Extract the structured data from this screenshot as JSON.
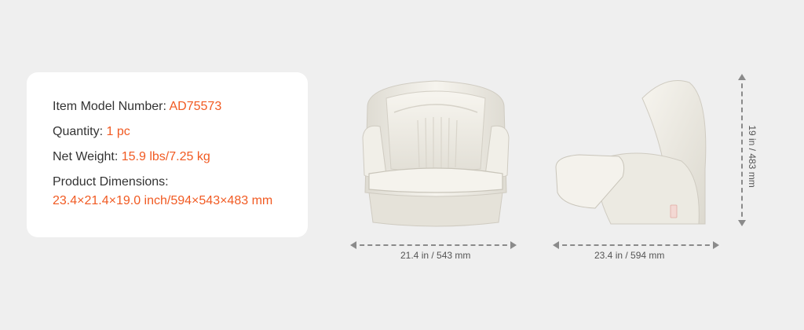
{
  "specs": {
    "model_label": "Item Model Number:",
    "model_value": "AD75573",
    "quantity_label": "Quantity:",
    "quantity_value": "1 pc",
    "weight_label": "Net Weight:",
    "weight_value": "15.9 lbs/7.25 kg",
    "dimensions_label": "Product Dimensions:",
    "dimensions_value": "23.4×21.4×19.0 inch/594×543×483 mm"
  },
  "dimensions": {
    "front_width": "21.4 in / 543 mm",
    "side_depth": "23.4 in / 594 mm",
    "height": "19 in / 483 mm"
  },
  "colors": {
    "accent": "#f15a22",
    "seat": "#f3f1ea",
    "background": "#efefef"
  }
}
